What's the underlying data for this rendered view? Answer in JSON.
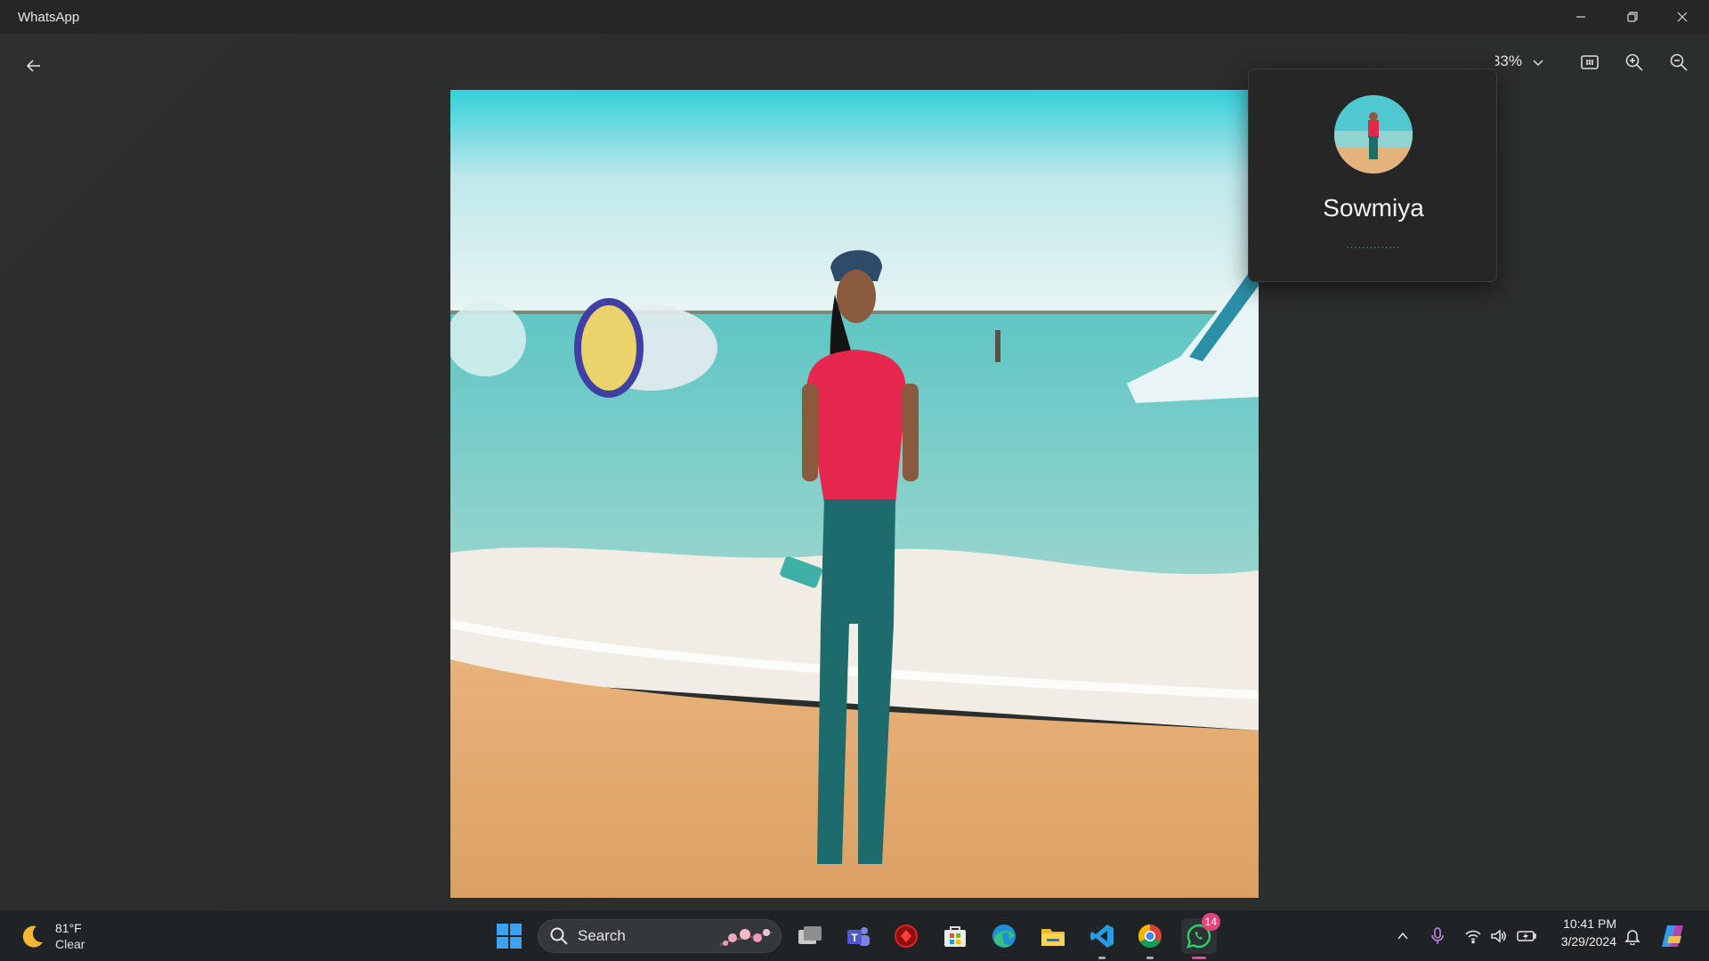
{
  "window": {
    "title": "WhatsApp"
  },
  "viewer": {
    "zoom_level": "33%",
    "photo_subject": "image"
  },
  "contact_popup": {
    "name": "Sowmiya",
    "status_dots": ".............."
  },
  "taskbar": {
    "weather": {
      "temperature": "81°F",
      "condition": "Clear",
      "icon": "moon-icon"
    },
    "search_placeholder": "Search",
    "pinned_apps": [
      "task-view",
      "teams",
      "red-app",
      "microsoft-store",
      "edge",
      "file-explorer",
      "vscode",
      "chrome",
      "whatsapp"
    ],
    "whatsapp_badge": "14",
    "clock": {
      "time": "10:41 PM",
      "date": "3/29/2024"
    }
  },
  "colors": {
    "titlebar": "#262626",
    "background": "#2b2b2b",
    "taskbar": "#1f2326",
    "accent_badge": "#e0457b",
    "whatsapp_green": "#25d366"
  }
}
